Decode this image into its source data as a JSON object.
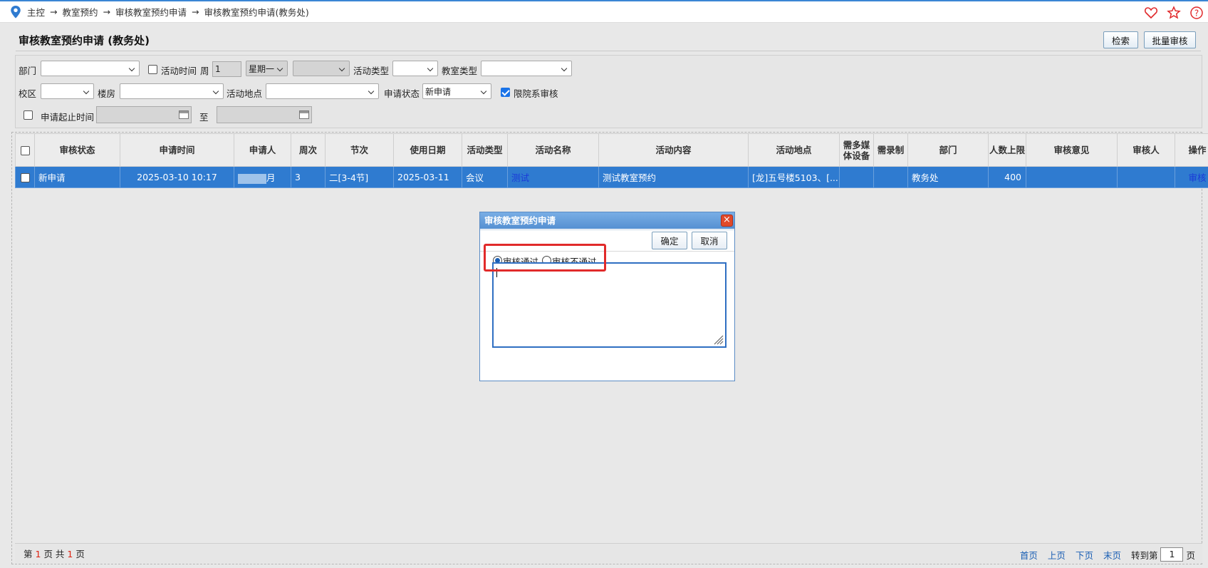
{
  "breadcrumb": [
    "主控",
    "教室预约",
    "审核教室预约申请",
    "审核教室预约申请(教务处)"
  ],
  "breadcrumb_arrow": "→",
  "page_title": "审核教室预约申请 (教务处)",
  "toolbar": {
    "search_label": "检索",
    "batch_label": "批量审核"
  },
  "filters": {
    "dept_label": "部门",
    "activity_time_label": "活动时间",
    "week_label": "周",
    "week_value": "1",
    "weekday_value": "星期一",
    "activity_type_label": "活动类型",
    "room_type_label": "教室类型",
    "campus_label": "校区",
    "building_label": "楼房",
    "location_label": "活动地点",
    "status_label": "申请状态",
    "status_value": "新申请",
    "limit_dept_label": "限院系审核",
    "apply_range_label": "申请起止时间",
    "to_label": "至"
  },
  "table": {
    "headers": [
      "审核状态",
      "申请时间",
      "申请人",
      "周次",
      "节次",
      "使用日期",
      "活动类型",
      "活动名称",
      "活动内容",
      "活动地点",
      "需多媒体设备",
      "需录制",
      "部门",
      "人数上限",
      "审核意见",
      "审核人",
      "操作"
    ],
    "row": {
      "status": "新申请",
      "apply_time": "2025-03-10 10:17",
      "applicant_suffix": "月",
      "week": "3",
      "period": "二[3-4节]",
      "use_date": "2025-03-11",
      "activity_type": "会议",
      "activity_name": "测试",
      "activity_content": "测试教室预约",
      "location": "[龙]五号楼5103、[...",
      "multimedia": "",
      "record": "",
      "dept": "教务处",
      "capacity": "400",
      "opinion": "",
      "reviewer": "",
      "action": "审核"
    }
  },
  "footer": {
    "page_prefix": "第",
    "current_page": "1",
    "page_mid": "页 共",
    "total_pages": "1",
    "page_suffix": "页",
    "first": "首页",
    "prev": "上页",
    "next": "下页",
    "last": "末页",
    "goto_label": "转到第",
    "goto_value": "1",
    "goto_suffix": "页"
  },
  "dialog": {
    "title": "审核教室预约申请",
    "close": "×",
    "ok_label": "确定",
    "cancel_label": "取消",
    "approve_label": "审核通过",
    "reject_label": "审核不通过",
    "remark_value": ""
  },
  "colors": {
    "accent": "#2f7bd0",
    "highlight": "#e12a2a",
    "link": "#1a5fb4"
  },
  "icons": [
    "location-pin-icon",
    "heart-icon",
    "star-icon",
    "help-icon",
    "calendar-icon",
    "close-icon",
    "resize-grip-icon"
  ]
}
